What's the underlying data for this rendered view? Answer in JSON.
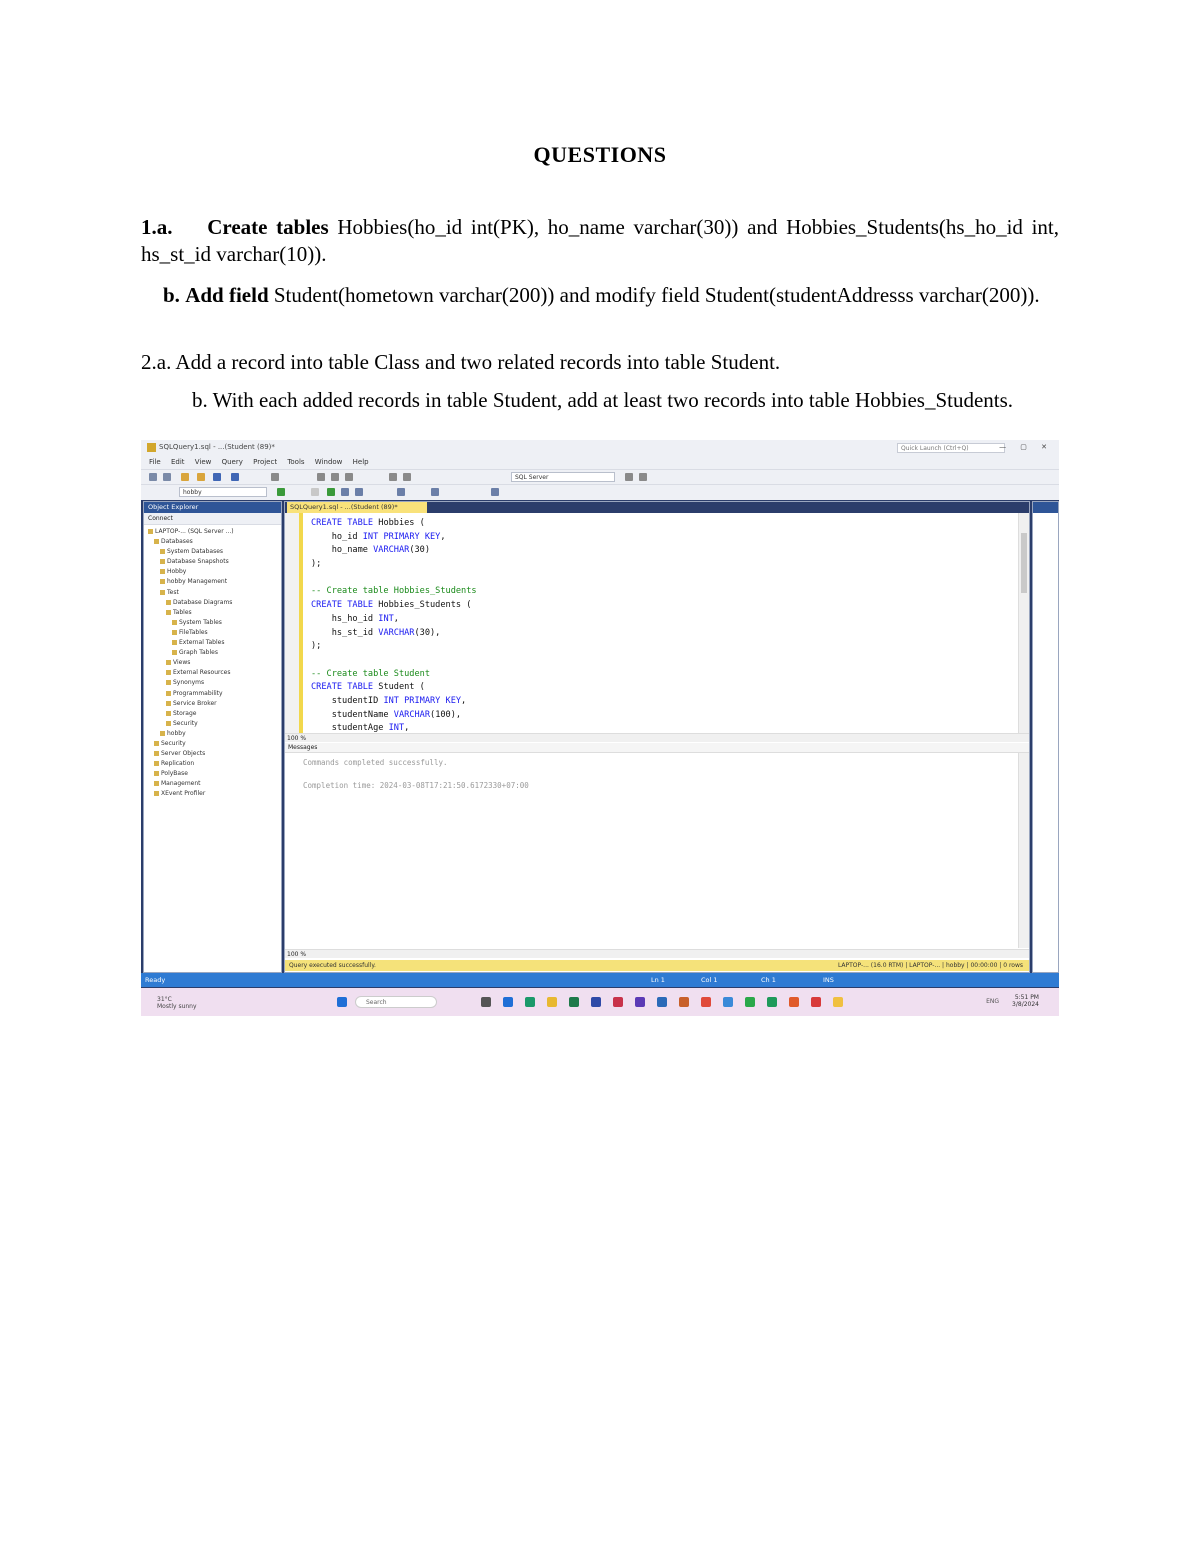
{
  "doc": {
    "title": "QUESTIONS",
    "q1a_label": "1.a.",
    "q1a_bold": "Create tables",
    "q1a_text": "Hobbies(ho_id int(PK), ho_name varchar(30)) and Hobbies_Students(hs_ho_id int, hs_st_id varchar(10)).",
    "q1b_label": "b.",
    "q1b_bold": "Add field",
    "q1b_text": "Student(hometown varchar(200)) and modify field Student(studentAddresss varchar(200)).",
    "q2a_text": "2.a. Add a record into table Class and two related records into table Student.",
    "q2b_text": "b. With each added records in table Student, add at least two records into table Hobbies_Students."
  },
  "screenshot": {
    "tab_label": "SQLQuery1.sql - ...(Student (89)*",
    "combo_db": "hobby",
    "combo_version": "SQL Server",
    "oe_title": "Object Explorer",
    "oe_connect": "Connect",
    "oe_items": [
      "LAPTOP-... (SQL Server ...)",
      "Databases",
      "System Databases",
      "Database Snapshots",
      "Hobby",
      "hobby Management",
      "Test",
      "Database Diagrams",
      "Tables",
      "System Tables",
      "FileTables",
      "External Tables",
      "Graph Tables",
      "Views",
      "External Resources",
      "Synonyms",
      "Programmability",
      "Service Broker",
      "Storage",
      "Security",
      "hobby",
      "Security",
      "Server Objects",
      "Replication",
      "PolyBase",
      "Management",
      "XEvent Profiler"
    ],
    "code_lines": [
      {
        "kw": "CREATE TABLE",
        "rest": " Hobbies (",
        "type": "",
        "tail": ""
      },
      {
        "kw": "",
        "rest": "    ho_id ",
        "type": "INT PRIMARY KEY",
        "tail": ","
      },
      {
        "kw": "",
        "rest": "    ho_name ",
        "type": "VARCHAR",
        "tail": "(30)"
      },
      {
        "kw": "",
        "rest": ");",
        "type": "",
        "tail": ""
      },
      {
        "kw": "",
        "rest": "",
        "type": "",
        "tail": ""
      },
      {
        "comment": "-- Create table Hobbies_Students"
      },
      {
        "kw": "CREATE TABLE",
        "rest": " Hobbies_Students (",
        "type": "",
        "tail": ""
      },
      {
        "kw": "",
        "rest": "    hs_ho_id ",
        "type": "INT",
        "tail": ","
      },
      {
        "kw": "",
        "rest": "    hs_st_id ",
        "type": "VARCHAR",
        "tail": "(30),"
      },
      {
        "kw": "",
        "rest": ");",
        "type": "",
        "tail": ""
      },
      {
        "kw": "",
        "rest": "",
        "type": "",
        "tail": ""
      },
      {
        "comment": "-- Create table Student"
      },
      {
        "kw": "CREATE TABLE",
        "rest": " Student (",
        "type": "",
        "tail": ""
      },
      {
        "kw": "",
        "rest": "    studentID ",
        "type": "INT PRIMARY KEY",
        "tail": ","
      },
      {
        "kw": "",
        "rest": "    studentName ",
        "type": "VARCHAR",
        "tail": "(100),"
      },
      {
        "kw": "",
        "rest": "    studentAge ",
        "type": "INT",
        "tail": ","
      }
    ],
    "zoom": "100 %",
    "messages_tab": "Messages",
    "msg1": "Commands completed successfully.",
    "msg2": "Completion time: 2024-03-08T17:21:50.6172330+07:00",
    "query_status": "Query executed successfully.",
    "query_status_right": "LAPTOP-... (16.0 RTM) | LAPTOP-... | hobby | 00:00:00 | 0 rows",
    "status_ready": "Ready",
    "status_ln": "Ln 1",
    "status_col": "Col 1",
    "status_ch": "Ch 1",
    "status_ins": "INS",
    "weather_temp": "31°C",
    "weather_desc": "Mostly sunny",
    "search": "Search",
    "tray": "ENG",
    "clock_time": "5:51 PM",
    "clock_date": "3/8/2024",
    "quick_launch": "Quick Launch (Ctrl+Q)",
    "colors": {
      "accent": "#2f5597",
      "status_bar": "#2f7bd3",
      "tab_highlight": "#f9e27a",
      "keyword": "#1a1af0",
      "comment": "#1a8a1a"
    }
  }
}
